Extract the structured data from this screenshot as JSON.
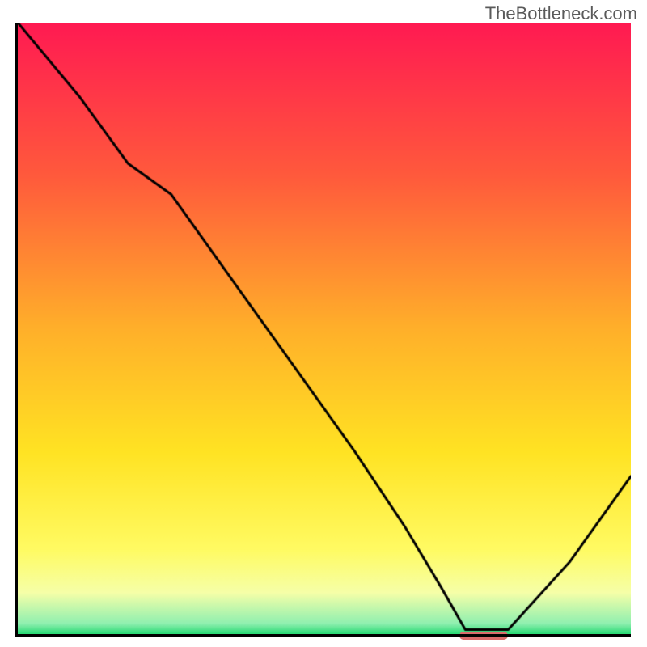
{
  "watermark": "TheBottleneck.com",
  "chart_data": {
    "type": "line",
    "title": "",
    "xlabel": "",
    "ylabel": "",
    "xlim": [
      0,
      100
    ],
    "ylim": [
      0,
      100
    ],
    "x": [
      0,
      10,
      18,
      25,
      35,
      45,
      55,
      63,
      69,
      73,
      80,
      90,
      100
    ],
    "values": [
      100,
      88,
      77,
      72,
      58,
      44,
      30,
      18,
      8,
      1,
      1,
      12,
      26
    ],
    "gradient_stops": [
      {
        "offset": 0.0,
        "color": "#ff1a52"
      },
      {
        "offset": 0.25,
        "color": "#ff5a3c"
      },
      {
        "offset": 0.5,
        "color": "#ffb02a"
      },
      {
        "offset": 0.7,
        "color": "#ffe323"
      },
      {
        "offset": 0.86,
        "color": "#fffb63"
      },
      {
        "offset": 0.93,
        "color": "#f6ffa8"
      },
      {
        "offset": 0.98,
        "color": "#90f0b0"
      },
      {
        "offset": 1.0,
        "color": "#18d66b"
      }
    ],
    "optimum_marker": {
      "x_start": 72,
      "x_end": 80,
      "y": 0,
      "color": "#d96b6b"
    }
  }
}
